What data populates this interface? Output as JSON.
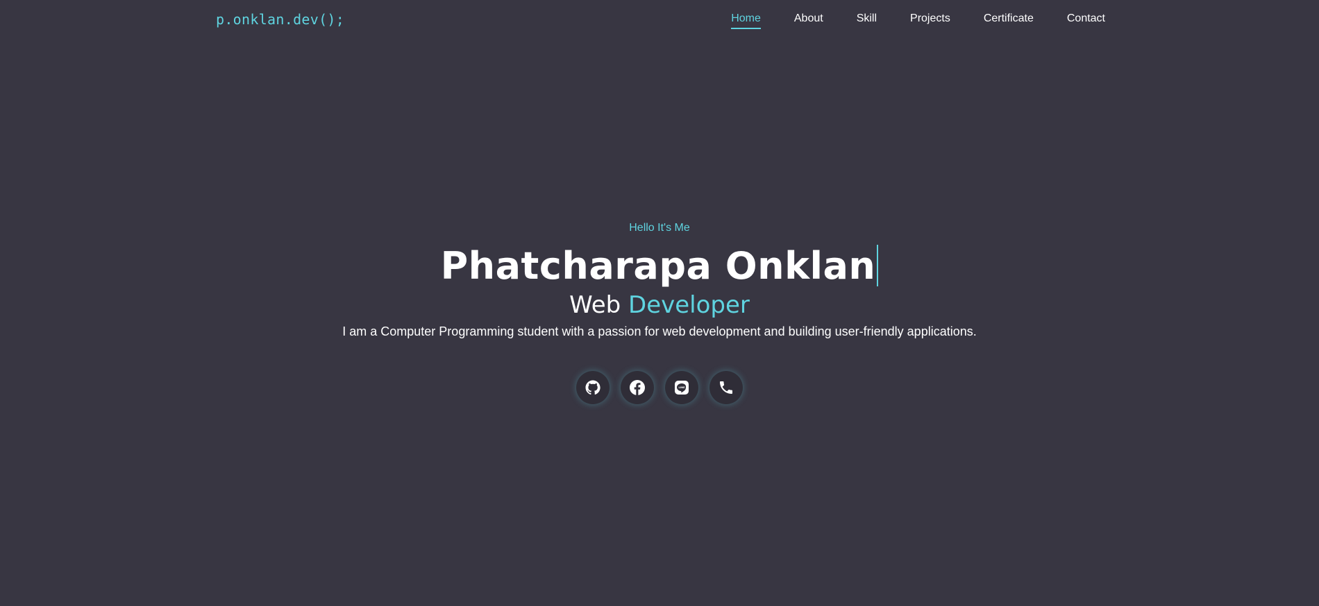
{
  "header": {
    "logo": "p.onklan.dev();",
    "nav": [
      {
        "label": "Home",
        "active": true
      },
      {
        "label": "About",
        "active": false
      },
      {
        "label": "Skill",
        "active": false
      },
      {
        "label": "Projects",
        "active": false
      },
      {
        "label": "Certificate",
        "active": false
      },
      {
        "label": "Contact",
        "active": false
      }
    ]
  },
  "hero": {
    "greeting": "Hello It's Me",
    "name": "Phatcharapa Onklan",
    "role_prefix": "Web",
    "role_accent": "Developer",
    "description": "I am a Computer Programming student with a passion for web development and building user-friendly applications."
  },
  "socials": [
    {
      "icon": "github-icon"
    },
    {
      "icon": "facebook-icon"
    },
    {
      "icon": "line-icon"
    },
    {
      "icon": "phone-icon"
    }
  ],
  "colors": {
    "background": "#383642",
    "accent": "#5fd4e0",
    "text": "#ffffff",
    "button_bg": "#2f2d37"
  }
}
